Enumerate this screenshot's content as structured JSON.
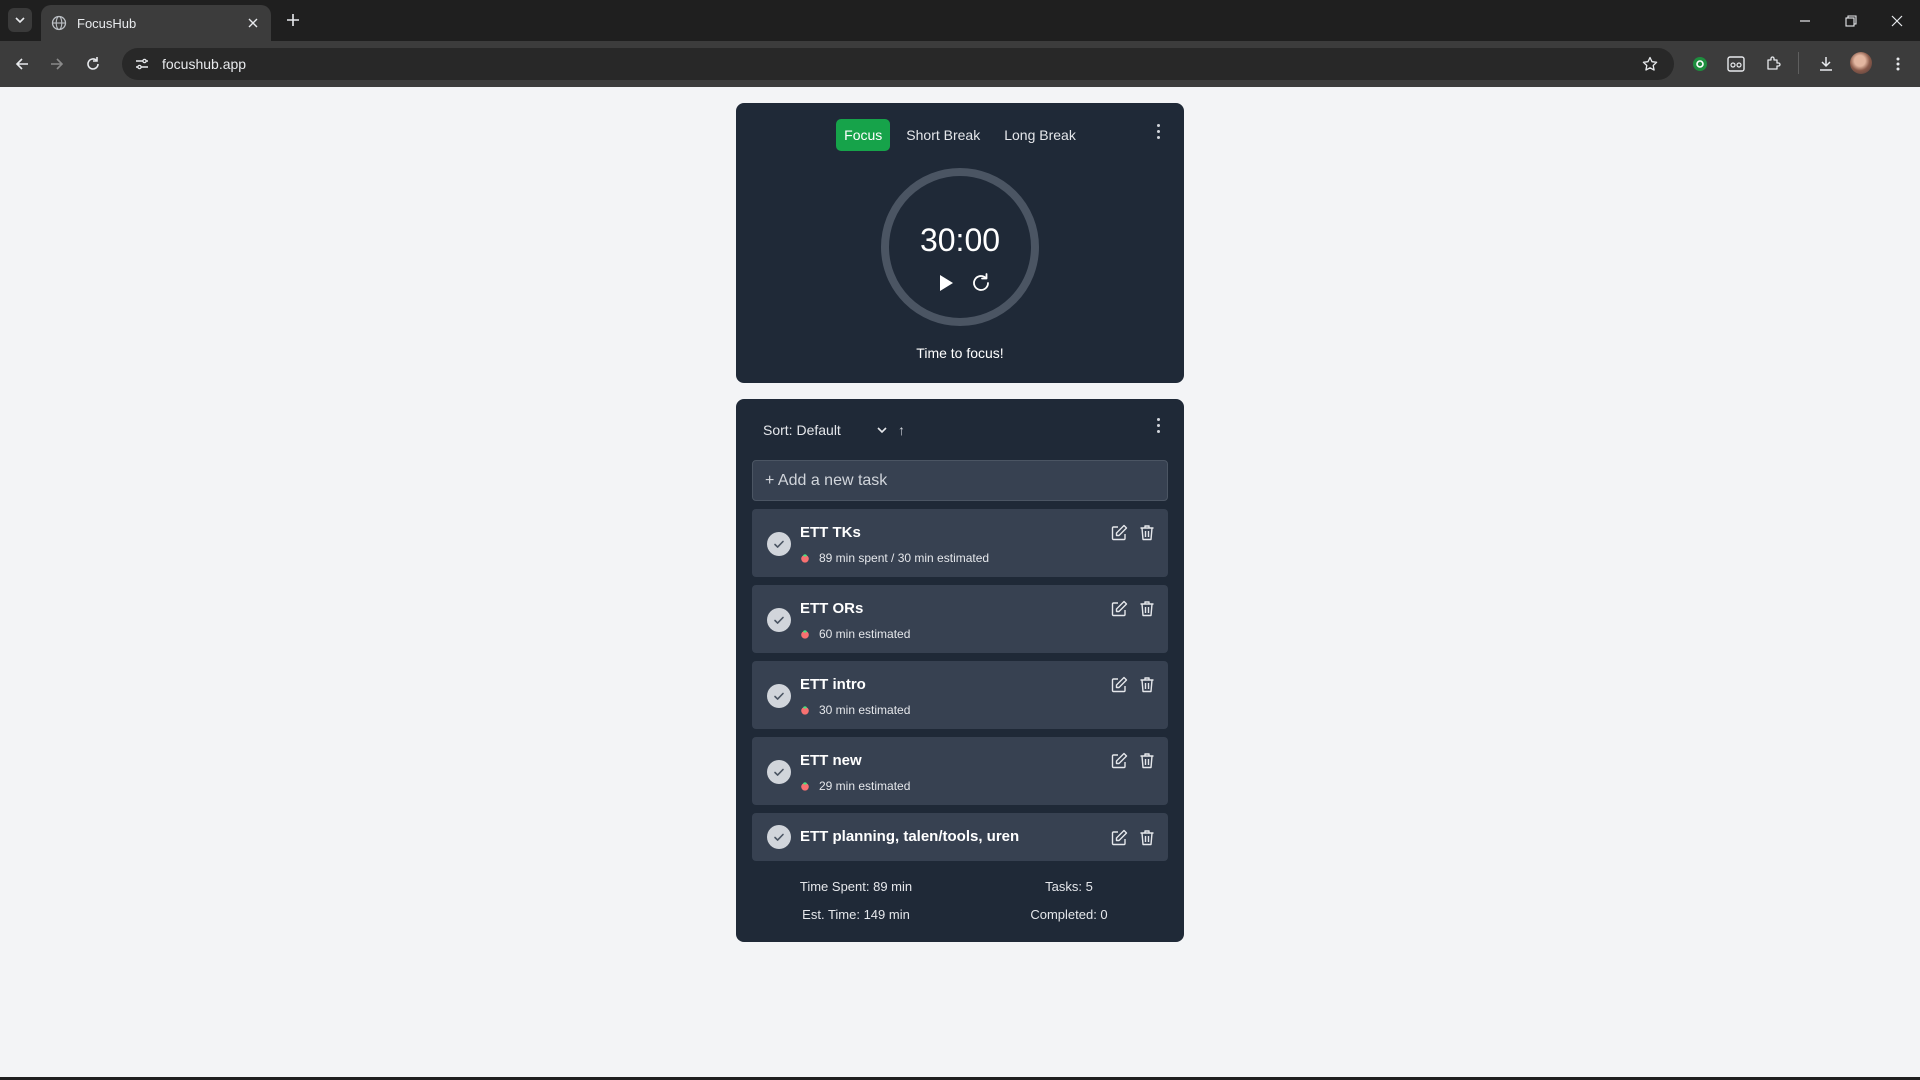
{
  "browser": {
    "tab_title": "FocusHub",
    "url": "focushub.app"
  },
  "timer": {
    "modes": [
      {
        "label": "Focus",
        "active": true
      },
      {
        "label": "Short Break",
        "active": false
      },
      {
        "label": "Long Break",
        "active": false
      }
    ],
    "time": "30:00",
    "progress": 0,
    "status": "Time to focus!"
  },
  "tasks": {
    "sort_label": "Sort: Default",
    "sort_direction": "↑",
    "add_placeholder": "+ Add a new task",
    "items": [
      {
        "name": "ETT TKs",
        "meta": "89 min spent / 30 min estimated",
        "completed": false
      },
      {
        "name": "ETT ORs",
        "meta": "60 min estimated",
        "completed": false
      },
      {
        "name": "ETT intro",
        "meta": "30 min estimated",
        "completed": false
      },
      {
        "name": "ETT new",
        "meta": "29 min estimated",
        "completed": false
      },
      {
        "name": "ETT planning, talen/tools, uren",
        "meta": "",
        "completed": false
      }
    ],
    "stats": {
      "time_spent": "Time Spent: 89 min",
      "tasks_count": "Tasks: 5",
      "est_time": "Est. Time: 149 min",
      "completed": "Completed: 0"
    }
  },
  "colors": {
    "accent": "#16a34a",
    "card_bg": "#1f2937",
    "task_bg": "#374151",
    "page_bg": "#f3f4f6"
  }
}
